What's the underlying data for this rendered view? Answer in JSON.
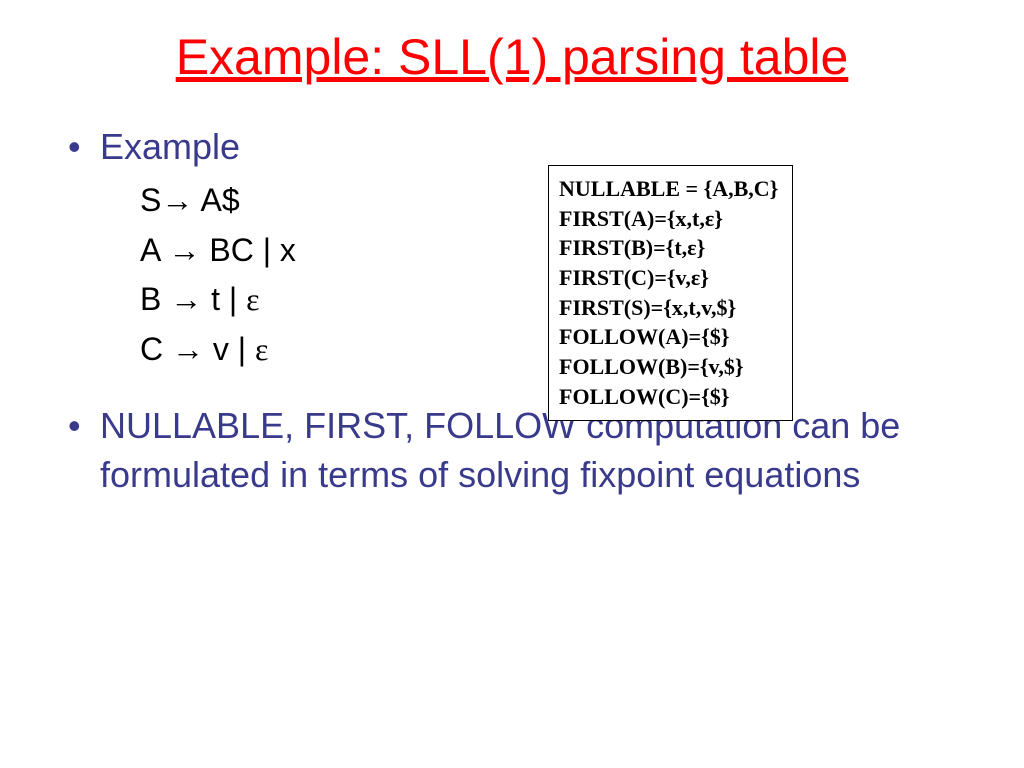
{
  "title": "Example: SLL(1) parsing table",
  "bullet1": "Example",
  "grammar": {
    "line1_lhs": "S",
    "line1_rhs": " A$",
    "line2_lhs": "A ",
    "line2_rhs": " BC | x",
    "line3_lhs": "B ",
    "line3_rhs_a": " t | ",
    "line4_lhs": "C ",
    "line4_rhs_a": " v | "
  },
  "epsilon": "ε",
  "arrow": "→",
  "bullet2": "NULLABLE, FIRST, FOLLOW computation can be formulated in terms of solving fixpoint equations",
  "info": {
    "l1": "NULLABLE = {A,B,C}",
    "l2a": "FIRST(A)={x,t,",
    "l2b": "}",
    "l3a": "FIRST(B)={t,",
    "l3b": "}",
    "l4a": "FIRST(C)={v,",
    "l4b": "}",
    "l5": "FIRST(S)={x,t,v,$}",
    "l6": "FOLLOW(A)={$}",
    "l7": "FOLLOW(B)={v,$}",
    "l8": "FOLLOW(C)={$}"
  }
}
